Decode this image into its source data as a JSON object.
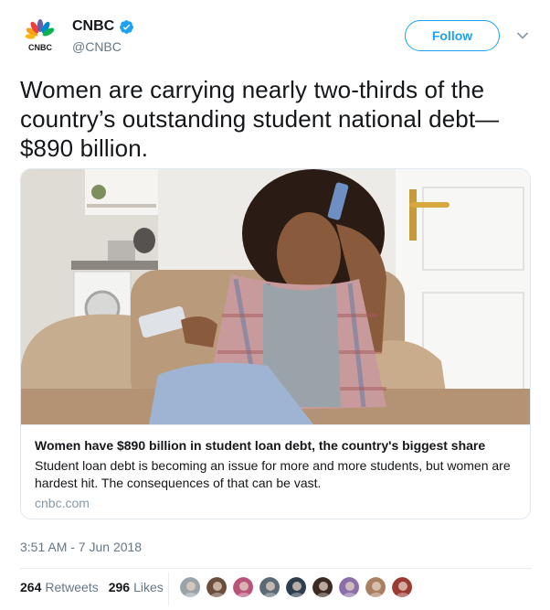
{
  "author": {
    "display_name": "CNBC",
    "handle": "@CNBC",
    "verified": true,
    "avatar_icon": "cnbc-peacock-logo",
    "logo_text": "CNBC"
  },
  "follow_button": {
    "label": "Follow"
  },
  "menu_icon": "chevron-down-icon",
  "tweet": {
    "text": "Women are carrying nearly two-thirds of the country’s outstanding student national debt—$890 billion."
  },
  "card": {
    "image_icon": "photo-woman-on-couch",
    "title": "Women have $890 billion in student loan debt, the country's biggest share",
    "description": "Student loan debt is becoming an issue for more and more students, but women are hardest hit. The consequences of that can be vast.",
    "domain": "cnbc.com"
  },
  "timestamp": "3:51 AM - 7 Jun 2018",
  "stats": {
    "retweets_count": "264",
    "retweets_label": "Retweets",
    "likes_count": "296",
    "likes_label": "Likes"
  },
  "likers": [
    {
      "color": "#9aa3a8",
      "icon": "avatar-icon"
    },
    {
      "color": "#6b4e3d",
      "icon": "avatar-icon"
    },
    {
      "color": "#b8547a",
      "icon": "avatar-icon"
    },
    {
      "color": "#5c6a78",
      "icon": "avatar-icon"
    },
    {
      "color": "#2d3e50",
      "icon": "avatar-icon"
    },
    {
      "color": "#3b2a22",
      "icon": "avatar-icon"
    },
    {
      "color": "#8a6fa8",
      "icon": "avatar-icon"
    },
    {
      "color": "#a87f63",
      "icon": "avatar-icon"
    },
    {
      "color": "#9a3b33",
      "icon": "avatar-icon"
    }
  ],
  "colors": {
    "accent": "#1da1f2",
    "secondary_text": "#657786",
    "border": "#e1e8ed"
  }
}
